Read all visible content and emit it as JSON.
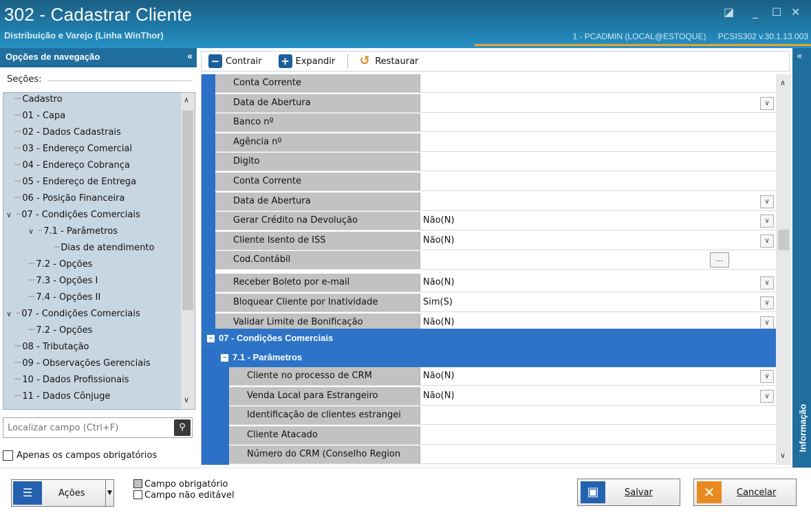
{
  "window": {
    "title": "302 - Cadastrar Cliente",
    "subtitle": "Distribuição e Varejo (Linha WinThor)",
    "user": "1 - PCADMIN (LOCAL@ESTOQUE)",
    "version": "PCSIS302  v.30.1.13.003"
  },
  "nav": {
    "header": "Opções de navegação",
    "sections_label": "Seções:",
    "tree": [
      {
        "label": "Cadastro",
        "chev": "",
        "dots": "···"
      },
      {
        "label": "01 - Capa",
        "chev": "",
        "dots": "···"
      },
      {
        "label": "02 - Dados Cadastrais",
        "chev": "",
        "dots": "···"
      },
      {
        "label": "03 - Endereço Comercial",
        "chev": "",
        "dots": "···"
      },
      {
        "label": "04 - Endereço Cobrança",
        "chev": "",
        "dots": "···"
      },
      {
        "label": "05 - Endereço de Entrega",
        "chev": "",
        "dots": "···"
      },
      {
        "label": "06 - Posição Financeira",
        "chev": "",
        "dots": "···"
      },
      {
        "label": "07 - Condições Comerciais",
        "chev": "⌄",
        "dots": "··"
      },
      {
        "label": "7.1 - Parâmetros",
        "chev": "⌄",
        "dots": "··"
      },
      {
        "label": "Dias de atendimento",
        "chev": "",
        "dots": "···"
      },
      {
        "label": "7.2 - Opções",
        "chev": "",
        "dots": "···"
      },
      {
        "label": "7.3 - Opções I",
        "chev": "",
        "dots": "···"
      },
      {
        "label": "7.4 - Opções II",
        "chev": "",
        "dots": "···"
      },
      {
        "label": "07 - Condições Comerciais",
        "chev": "⌄",
        "dots": "··"
      },
      {
        "label": "7.2 - Opções",
        "chev": "",
        "dots": "···"
      },
      {
        "label": "08 - Tributação",
        "chev": "",
        "dots": "···"
      },
      {
        "label": "09 - Observações Gerenciais",
        "chev": "",
        "dots": "···"
      },
      {
        "label": "10 - Dados Profissionais",
        "chev": "",
        "dots": "···"
      },
      {
        "label": "11 - Dados Cônjuge",
        "chev": "",
        "dots": "···"
      }
    ],
    "search_placeholder": "Localizar campo (Ctrl+F)",
    "only_required": "Apenas os campos obrigatórios"
  },
  "toolbar": {
    "contrair": "Contrair",
    "expandir": "Expandir",
    "restaurar": "Restaurar"
  },
  "grid": {
    "rows": [
      {
        "label": "Conta Corrente",
        "value": "",
        "type": "text"
      },
      {
        "label": "Data de Abertura",
        "value": "",
        "type": "dropdown"
      },
      {
        "label": "Banco nº",
        "value": "",
        "type": "text"
      },
      {
        "label": "Agência nº",
        "value": "",
        "type": "text"
      },
      {
        "label": "Digito",
        "value": "",
        "type": "text"
      },
      {
        "label": "Conta Corrente",
        "value": "",
        "type": "text"
      },
      {
        "label": "Data de Abertura",
        "value": "",
        "type": "dropdown"
      },
      {
        "label": "Gerar Crédito na Devolução",
        "value": "Não(N)",
        "type": "dropdown"
      },
      {
        "label": "Cliente Isento de ISS",
        "value": "Não(N)",
        "type": "dropdown"
      },
      {
        "label": "Cod.Contábil",
        "value": "",
        "type": "ellipsis"
      },
      {
        "label": "Receber Boleto por e-mail",
        "value": "Não(N)",
        "type": "dropdown"
      },
      {
        "label": "Bloquear Cliente por Inatividade",
        "value": "Sim(S)",
        "type": "dropdown"
      },
      {
        "label": "Validar Limite de Bonificação",
        "value": "Não(N)",
        "type": "dropdown"
      }
    ],
    "category": "07 - Condições Comerciais",
    "subcategory": "7.1 - Parâmetros",
    "sub_rows": [
      {
        "label": "Cliente no processo de CRM",
        "value": "Não(N)",
        "type": "dropdown"
      },
      {
        "label": "Venda Local para Estrangeiro",
        "value": "Não(N)",
        "type": "dropdown"
      },
      {
        "label": "Identificação de clientes estrangei",
        "value": "",
        "type": "text"
      },
      {
        "label": "Cliente Atacado",
        "value": "",
        "type": "text"
      },
      {
        "label": "Número do CRM (Conselho Region",
        "value": "",
        "type": "text"
      }
    ]
  },
  "info_label": "Informação",
  "bottom": {
    "acoes": "Ações",
    "legend_required": "Campo obrigatório",
    "legend_readonly": "Campo não editável",
    "salvar": "Salvar",
    "cancelar": "Cancelar"
  },
  "colors": {
    "accent": "#1f6e9e",
    "category": "#2d74c8",
    "label_bg": "#c2c2c2",
    "orange": "#e98a1f"
  }
}
